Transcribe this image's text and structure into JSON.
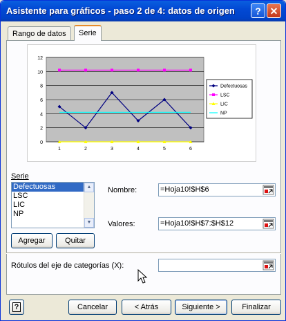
{
  "window": {
    "title": "Asistente para gráficos - paso 2 de 4: datos de origen",
    "help_glyph": "?",
    "close_glyph": "✕"
  },
  "tabs": [
    {
      "label": "Rango de datos",
      "active": false
    },
    {
      "label": "Serie",
      "active": true
    }
  ],
  "chart_data": {
    "type": "line",
    "categories": [
      "1",
      "2",
      "3",
      "4",
      "5",
      "6"
    ],
    "ylim": [
      0,
      12
    ],
    "yticks": [
      "0",
      "2",
      "4",
      "6",
      "8",
      "10",
      "12"
    ],
    "grid": true,
    "plot_background": "#c0c0c0",
    "legend_placement": "right",
    "series": [
      {
        "name": "Defectuosas",
        "values": [
          5,
          2,
          7,
          3,
          6,
          2
        ],
        "color": "#000080",
        "marker": "diamond"
      },
      {
        "name": "LSC",
        "values": [
          10.2,
          10.2,
          10.2,
          10.2,
          10.2,
          10.2
        ],
        "color": "#ff00ff",
        "marker": "square"
      },
      {
        "name": "LIC",
        "values": [
          0,
          0,
          0,
          0,
          0,
          0
        ],
        "color": "#ffff00",
        "marker": "triangle"
      },
      {
        "name": "NP",
        "values": [
          4.2,
          4.2,
          4.2,
          4.2,
          4.2,
          4.2
        ],
        "color": "#00ffff",
        "marker": "none"
      }
    ]
  },
  "serie_section": {
    "label": "Serie",
    "items": [
      "Defectuosas",
      "LSC",
      "LIC",
      "NP"
    ],
    "selected": "Defectuosas",
    "add_button": "Agregar",
    "remove_button": "Quitar"
  },
  "nombre": {
    "label": "Nombre:",
    "value": "=Hoja10!$H$6"
  },
  "valores": {
    "label": "Valores:",
    "value": "=Hoja10!$H$7:$H$12"
  },
  "rotulos": {
    "label": "Rótulos del eje de categorías (X):",
    "value": ""
  },
  "footer": {
    "help_glyph": "?",
    "cancel": "Cancelar",
    "back": "< Atrás",
    "next": "Siguiente >",
    "finish": "Finalizar"
  }
}
